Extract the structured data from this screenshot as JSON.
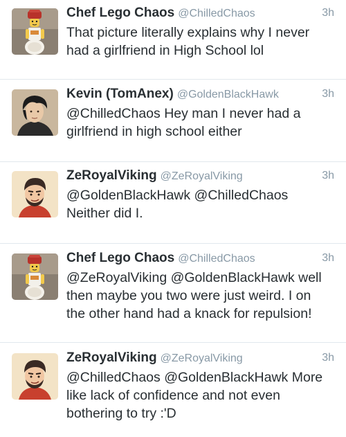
{
  "tweets": [
    {
      "display_name": "Chef Lego Chaos",
      "handle": "@ChilledChaos",
      "time": "3h",
      "lines": [
        "That picture literally explains why I never",
        "had a girlfriend in High School lol"
      ]
    },
    {
      "display_name": "Kevin (TomAnex)",
      "handle": "@GoldenBlackHawk",
      "time": "3h",
      "lines": [
        "@ChilledChaos Hey man I never had a",
        "girlfriend in high school either"
      ]
    },
    {
      "display_name": "ZeRoyalViking",
      "handle": "@ZeRoyalViking",
      "time": "3h",
      "lines": [
        "@GoldenBlackHawk @ChilledChaos",
        "Neither did I."
      ]
    },
    {
      "display_name": "Chef Lego Chaos",
      "handle": "@ChilledChaos",
      "time": "3h",
      "lines": [
        "@ZeRoyalViking @GoldenBlackHawk well",
        "then maybe you two were just weird. I on",
        "the other hand had a knack for repulsion!"
      ]
    },
    {
      "display_name": "ZeRoyalViking",
      "handle": "@ZeRoyalViking",
      "time": "3h",
      "lines": [
        "@ChilledChaos @GoldenBlackHawk More",
        "like lack of confidence and not even",
        "bothering to try :'D"
      ]
    }
  ]
}
